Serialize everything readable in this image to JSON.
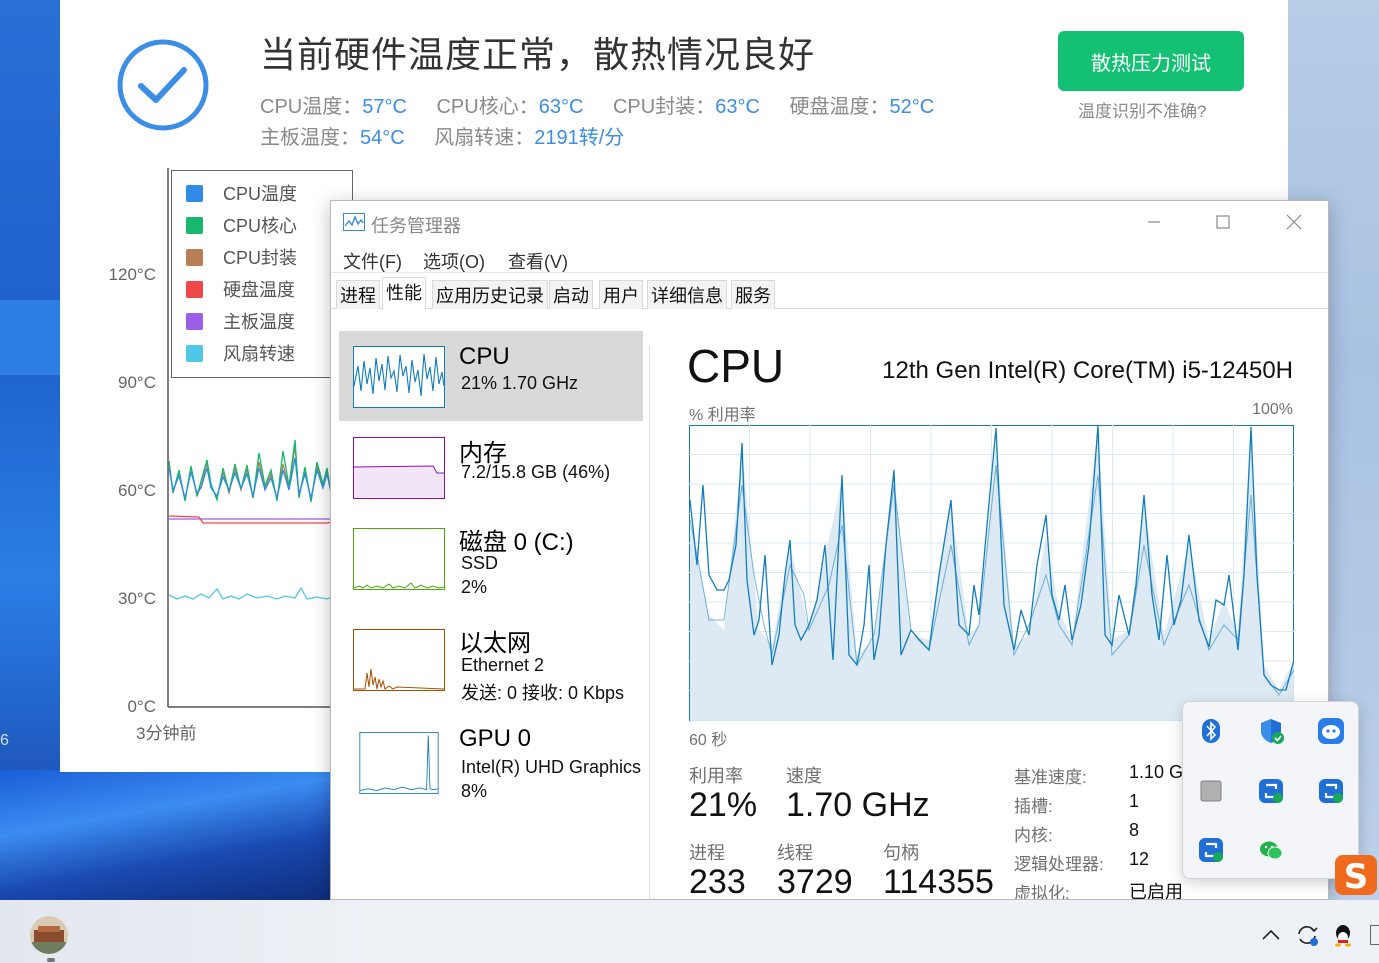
{
  "temp_monitor": {
    "headline": "当前硬件温度正常，散热情况良好",
    "stats_row1": [
      {
        "label": "CPU温度：",
        "value": "57°C"
      },
      {
        "label": "CPU核心：",
        "value": "63°C"
      },
      {
        "label": "CPU封装：",
        "value": "63°C"
      },
      {
        "label": "硬盘温度：",
        "value": "52°C"
      }
    ],
    "stats_row2": [
      {
        "label": "主板温度：",
        "value": "54°C"
      },
      {
        "label": "风扇转速：",
        "value": "2191转/分"
      }
    ],
    "stress_button": "散热压力测试",
    "inaccurate_link": "温度识别不准确?",
    "y_ticks": [
      "120°C",
      "90°C",
      "60°C",
      "30°C",
      "0°C"
    ],
    "x_tick_start": "3分钟前",
    "legend": [
      {
        "label": "CPU温度",
        "color": "#2f8be6"
      },
      {
        "label": "CPU核心",
        "color": "#17b86c"
      },
      {
        "label": "CPU封装",
        "color": "#b97e56"
      },
      {
        "label": "硬盘温度",
        "color": "#f04848"
      },
      {
        "label": "主板温度",
        "color": "#9b5ee6"
      },
      {
        "label": "风扇转速",
        "color": "#4ec8e6"
      }
    ]
  },
  "task_manager": {
    "title": "任务管理器",
    "menu": [
      "文件(F)",
      "选项(O)",
      "查看(V)"
    ],
    "tabs": [
      "进程",
      "性能",
      "应用历史记录",
      "启动",
      "用户",
      "详细信息",
      "服务"
    ],
    "sidebar": [
      {
        "title": "CPU",
        "lines": [
          "21%  1.70 GHz"
        ]
      },
      {
        "title": "内存",
        "lines": [
          "7.2/15.8 GB (46%)"
        ]
      },
      {
        "title": "磁盘 0 (C:)",
        "lines": [
          "SSD",
          "2%"
        ]
      },
      {
        "title": "以太网",
        "lines": [
          "Ethernet 2",
          "发送: 0  接收: 0 Kbps"
        ]
      },
      {
        "title": "GPU 0",
        "lines": [
          "Intel(R) UHD Graphics",
          "8%"
        ]
      }
    ],
    "cpu": {
      "heading": "CPU",
      "model": "12th Gen Intel(R) Core(TM) i5-12450H",
      "util_label": "% 利用率",
      "util_max": "100%",
      "time_label": "60 秒",
      "metrics": {
        "utilization_label": "利用率",
        "utilization": "21%",
        "speed_label": "速度",
        "speed": "1.70 GHz",
        "processes_label": "进程",
        "processes": "233",
        "threads_label": "线程",
        "threads": "3729",
        "handles_label": "句柄",
        "handles": "114355"
      },
      "specs": [
        {
          "label": "基准速度:",
          "value": "1.10 G"
        },
        {
          "label": "插槽:",
          "value": "1"
        },
        {
          "label": "内核:",
          "value": "8"
        },
        {
          "label": "逻辑处理器:",
          "value": "12"
        },
        {
          "label": "虚拟化:",
          "value": "已启用"
        }
      ]
    },
    "accent_cpu": "#117dbb",
    "accent_memory": "#8b12ae",
    "accent_disk": "#4da60c",
    "accent_network": "#a74f01"
  },
  "desktop": {
    "left_edge_number": "6"
  },
  "tray_popup_icons": [
    "bluetooth-icon",
    "defender-shield-icon",
    "baidu-netdisk-icon",
    "gray-app-icon",
    "sync-app-icon",
    "sync-app-icon",
    "sync-app-icon",
    "wechat-icon"
  ],
  "taskbar_icons": [
    "chevron-up-icon",
    "sync-icon",
    "qq-icon"
  ]
}
